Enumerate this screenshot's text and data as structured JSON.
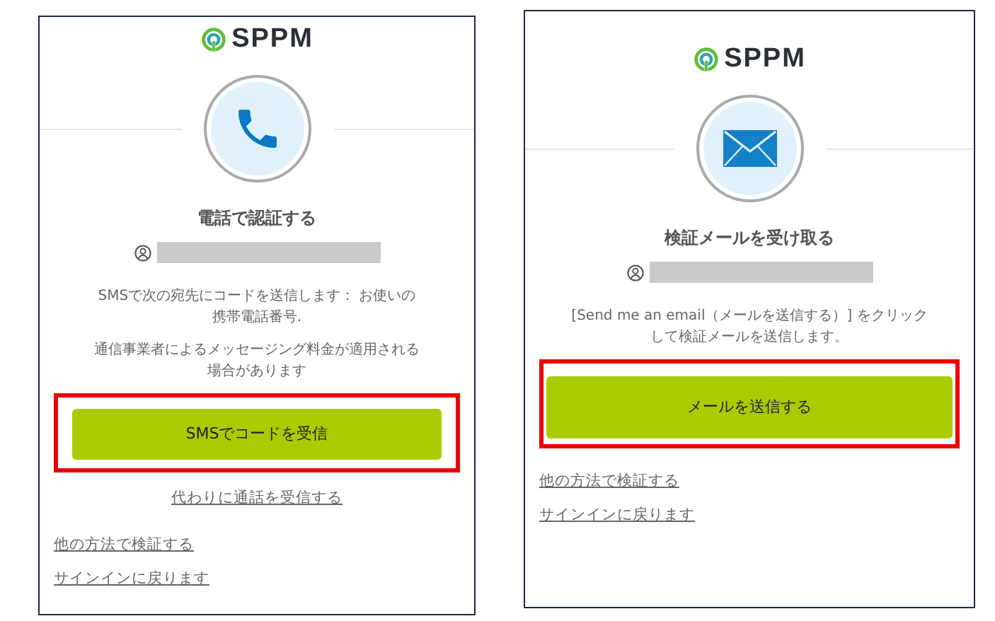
{
  "panels": [
    {
      "brand": "SPPM",
      "kind": "phone",
      "title": "電話で認証する",
      "messages": [
        "SMSで次の宛先にコードを送信します： お使いの携帯電話番号.",
        "通信事業者によるメッセージング料金が適用される場合があります"
      ],
      "button": {
        "label": "SMSでコードを受信",
        "highlighted": true
      },
      "alt_link": "代わりに通話を受信する",
      "links": [
        "他の方法で検証する",
        "サインインに戻ります"
      ]
    },
    {
      "brand": "SPPM",
      "kind": "envelope",
      "title": "検証メールを受け取る",
      "messages": [
        "[Send me an email（メールを送信する）] をクリックして検証メールを送信します。"
      ],
      "button": {
        "label": "メールを送信する",
        "highlighted": true
      },
      "links": [
        "他の方法で検証する",
        "サインインに戻ります"
      ]
    }
  ]
}
